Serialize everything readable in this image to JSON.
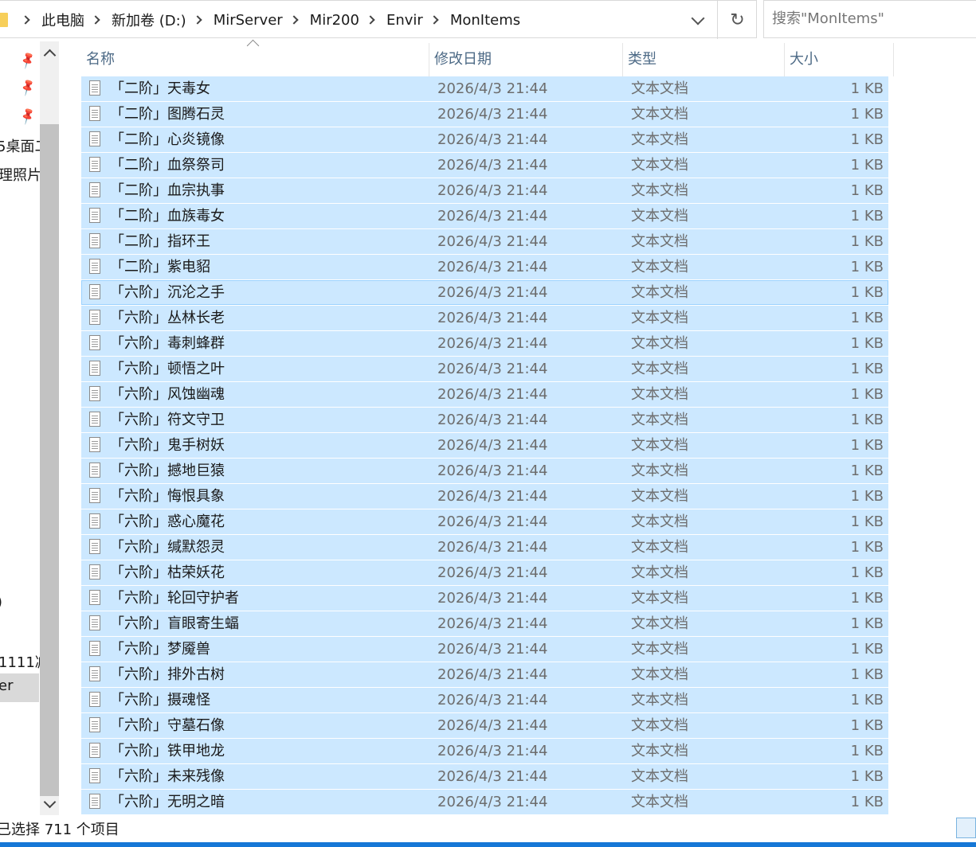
{
  "breadcrumb": [
    "此电脑",
    "新加卷 (D:)",
    "MirServer",
    "Mir200",
    "Envir",
    "MonItems"
  ],
  "search": {
    "placeholder": "搜索\"MonItems\""
  },
  "nav": {
    "items": [
      "5桌面二",
      "理照片",
      ")",
      "1111减",
      "er",
      ")"
    ]
  },
  "columns": {
    "name": "名称",
    "date": "修改日期",
    "type": "类型",
    "size": "大小"
  },
  "files": [
    {
      "name": "「二阶」天毒女",
      "date": "2026/4/3 21:44",
      "type": "文本文档",
      "size": "1 KB"
    },
    {
      "name": "「二阶」图腾石灵",
      "date": "2026/4/3 21:44",
      "type": "文本文档",
      "size": "1 KB"
    },
    {
      "name": "「二阶」心炎镜像",
      "date": "2026/4/3 21:44",
      "type": "文本文档",
      "size": "1 KB"
    },
    {
      "name": "「二阶」血祭祭司",
      "date": "2026/4/3 21:44",
      "type": "文本文档",
      "size": "1 KB"
    },
    {
      "name": "「二阶」血宗执事",
      "date": "2026/4/3 21:44",
      "type": "文本文档",
      "size": "1 KB"
    },
    {
      "name": "「二阶」血族毒女",
      "date": "2026/4/3 21:44",
      "type": "文本文档",
      "size": "1 KB"
    },
    {
      "name": "「二阶」指环王",
      "date": "2026/4/3 21:44",
      "type": "文本文档",
      "size": "1 KB"
    },
    {
      "name": "「二阶」紫电貂",
      "date": "2026/4/3 21:44",
      "type": "文本文档",
      "size": "1 KB"
    },
    {
      "name": "「六阶」沉沦之手",
      "date": "2026/4/3 21:44",
      "type": "文本文档",
      "size": "1 KB"
    },
    {
      "name": "「六阶」丛林长老",
      "date": "2026/4/3 21:44",
      "type": "文本文档",
      "size": "1 KB"
    },
    {
      "name": "「六阶」毒刺蜂群",
      "date": "2026/4/3 21:44",
      "type": "文本文档",
      "size": "1 KB"
    },
    {
      "name": "「六阶」顿悟之叶",
      "date": "2026/4/3 21:44",
      "type": "文本文档",
      "size": "1 KB"
    },
    {
      "name": "「六阶」风蚀幽魂",
      "date": "2026/4/3 21:44",
      "type": "文本文档",
      "size": "1 KB"
    },
    {
      "name": "「六阶」符文守卫",
      "date": "2026/4/3 21:44",
      "type": "文本文档",
      "size": "1 KB"
    },
    {
      "name": "「六阶」鬼手树妖",
      "date": "2026/4/3 21:44",
      "type": "文本文档",
      "size": "1 KB"
    },
    {
      "name": "「六阶」撼地巨猿",
      "date": "2026/4/3 21:44",
      "type": "文本文档",
      "size": "1 KB"
    },
    {
      "name": "「六阶」悔恨具象",
      "date": "2026/4/3 21:44",
      "type": "文本文档",
      "size": "1 KB"
    },
    {
      "name": "「六阶」惑心魔花",
      "date": "2026/4/3 21:44",
      "type": "文本文档",
      "size": "1 KB"
    },
    {
      "name": "「六阶」缄默怨灵",
      "date": "2026/4/3 21:44",
      "type": "文本文档",
      "size": "1 KB"
    },
    {
      "name": "「六阶」枯荣妖花",
      "date": "2026/4/3 21:44",
      "type": "文本文档",
      "size": "1 KB"
    },
    {
      "name": "「六阶」轮回守护者",
      "date": "2026/4/3 21:44",
      "type": "文本文档",
      "size": "1 KB"
    },
    {
      "name": "「六阶」盲眼寄生蝠",
      "date": "2026/4/3 21:44",
      "type": "文本文档",
      "size": "1 KB"
    },
    {
      "name": "「六阶」梦魇兽",
      "date": "2026/4/3 21:44",
      "type": "文本文档",
      "size": "1 KB"
    },
    {
      "name": "「六阶」排外古树",
      "date": "2026/4/3 21:44",
      "type": "文本文档",
      "size": "1 KB"
    },
    {
      "name": "「六阶」摄魂怪",
      "date": "2026/4/3 21:44",
      "type": "文本文档",
      "size": "1 KB"
    },
    {
      "name": "「六阶」守墓石像",
      "date": "2026/4/3 21:44",
      "type": "文本文档",
      "size": "1 KB"
    },
    {
      "name": "「六阶」铁甲地龙",
      "date": "2026/4/3 21:44",
      "type": "文本文档",
      "size": "1 KB"
    },
    {
      "name": "「六阶」未来残像",
      "date": "2026/4/3 21:44",
      "type": "文本文档",
      "size": "1 KB"
    },
    {
      "name": "「六阶」无明之暗",
      "date": "2026/4/3 21:44",
      "type": "文本文档",
      "size": "1 KB"
    }
  ],
  "status": {
    "text": "已选择 711 个项目"
  },
  "colors": {
    "selection": "#cce8ff",
    "focus_border": "#99d1ff",
    "header_text": "#4d6a86"
  }
}
